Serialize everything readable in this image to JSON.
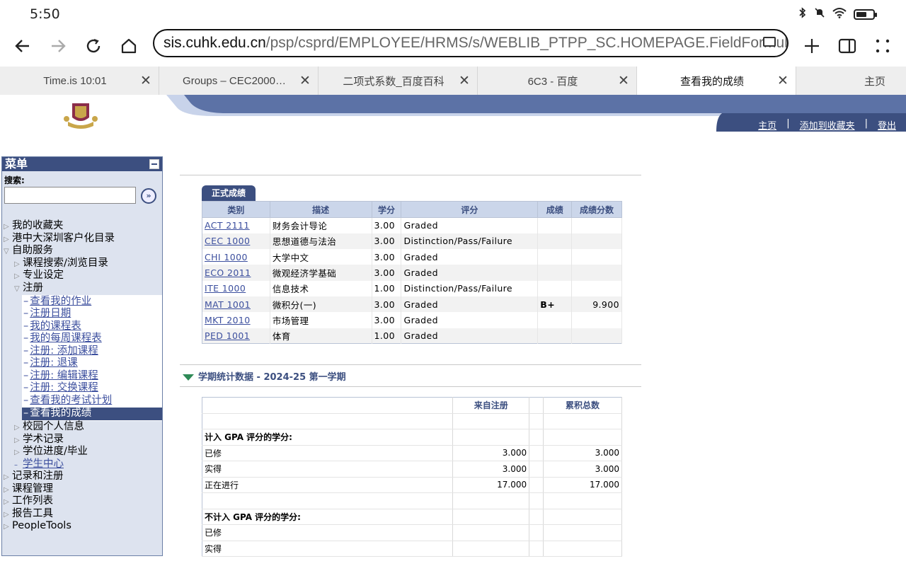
{
  "status_bar": {
    "time": "5:50",
    "icons": [
      "bluetooth-icon",
      "mute-icon",
      "wifi-icon",
      "battery-icon"
    ]
  },
  "browser": {
    "url_host": "sis.cuhk.edu.cn",
    "url_path": "/psp/csprd/EMPLOYEE/HRMS/s/WEBLIB_PTPP_SC.HOMEPAGE.FieldFormula.",
    "tabs": [
      {
        "label": "Time.is 10:01",
        "active": false
      },
      {
        "label": "Groups – CEC2000…",
        "active": false
      },
      {
        "label": "二项式系数_百度百科",
        "active": false
      },
      {
        "label": "6C3 - 百度",
        "active": false
      },
      {
        "label": "查看我的成绩",
        "active": true
      },
      {
        "label": "主页",
        "active": false
      }
    ]
  },
  "header_links": {
    "home": "主页",
    "add_favorites": "添加到收藏夹",
    "logout": "登出",
    "sep": "|"
  },
  "menu": {
    "title": "菜单",
    "search_label": "搜索:",
    "items": {
      "favorites": "我的收藏夹",
      "custom_catalog": "港中大深圳客户化目录",
      "self_service": "自助服务",
      "class_search": "课程搜索/浏览目录",
      "major": "专业设定",
      "enrollment": "注册",
      "campus_personal": "校园个人信息",
      "academic_records": "学术记录",
      "degree_progress": "学位进度/毕业",
      "student_center": "学生中心",
      "records_enrollment": "记录和注册",
      "curriculum": "课程管理",
      "worklist": "工作列表",
      "reporting": "报告工具",
      "peopletools": "PeopleTools"
    },
    "enroll_sub": [
      "查看我的作业",
      "注册日期",
      "我的课程表",
      "我的每周课程表",
      "注册: 添加课程",
      "注册: 退课",
      "注册: 编辑课程",
      "注册: 交换课程",
      "查看我的考试计划",
      "查看我的成绩"
    ]
  },
  "grades": {
    "tab_label": "正式成绩",
    "headers": [
      "类别",
      "描述",
      "学分",
      "评分",
      "成绩",
      "成绩分数"
    ],
    "rows": [
      {
        "code": "ACT 2111",
        "desc": "财务会计导论",
        "units": "3.00",
        "basis": "Graded",
        "grade": "",
        "points": ""
      },
      {
        "code": "CEC 1000",
        "desc": "思想道德与法治",
        "units": "3.00",
        "basis": "Distinction/Pass/Failure",
        "grade": "",
        "points": ""
      },
      {
        "code": "CHI 1000",
        "desc": "大学中文",
        "units": "3.00",
        "basis": "Graded",
        "grade": "",
        "points": ""
      },
      {
        "code": "ECO 2011",
        "desc": "微观经济学基础",
        "units": "3.00",
        "basis": "Graded",
        "grade": "",
        "points": ""
      },
      {
        "code": "ITE 1000",
        "desc": "信息技术",
        "units": "1.00",
        "basis": "Distinction/Pass/Failure",
        "grade": "",
        "points": ""
      },
      {
        "code": "MAT 1001",
        "desc": "微积分(一)",
        "units": "3.00",
        "basis": "Graded",
        "grade": "B+",
        "points": "9.900"
      },
      {
        "code": "MKT 2010",
        "desc": "市场管理",
        "units": "3.00",
        "basis": "Graded",
        "grade": "",
        "points": ""
      },
      {
        "code": "PED 1001",
        "desc": "体育",
        "units": "1.00",
        "basis": "Graded",
        "grade": "",
        "points": ""
      }
    ]
  },
  "stats": {
    "title": "学期统计数据 - 2024-25 第一学期",
    "col_term": "来自注册",
    "col_cum": "累积总数",
    "gpa_section": "计入 GPA 评分的学分:",
    "gpa_rows": [
      {
        "label": "已修",
        "term": "3.000",
        "cum": "3.000"
      },
      {
        "label": "实得",
        "term": "3.000",
        "cum": "3.000"
      },
      {
        "label": "正在进行",
        "term": "17.000",
        "cum": "17.000"
      }
    ],
    "nongpa_section": "不计入 GPA 评分的学分:",
    "nongpa_rows": [
      {
        "label": "已修",
        "term": "",
        "cum": ""
      },
      {
        "label": "实得",
        "term": "",
        "cum": ""
      }
    ]
  },
  "colors": {
    "nav_blue": "#3c4f80",
    "header_blue": "#cbd6ea",
    "accent_green": "#2f8a57"
  }
}
